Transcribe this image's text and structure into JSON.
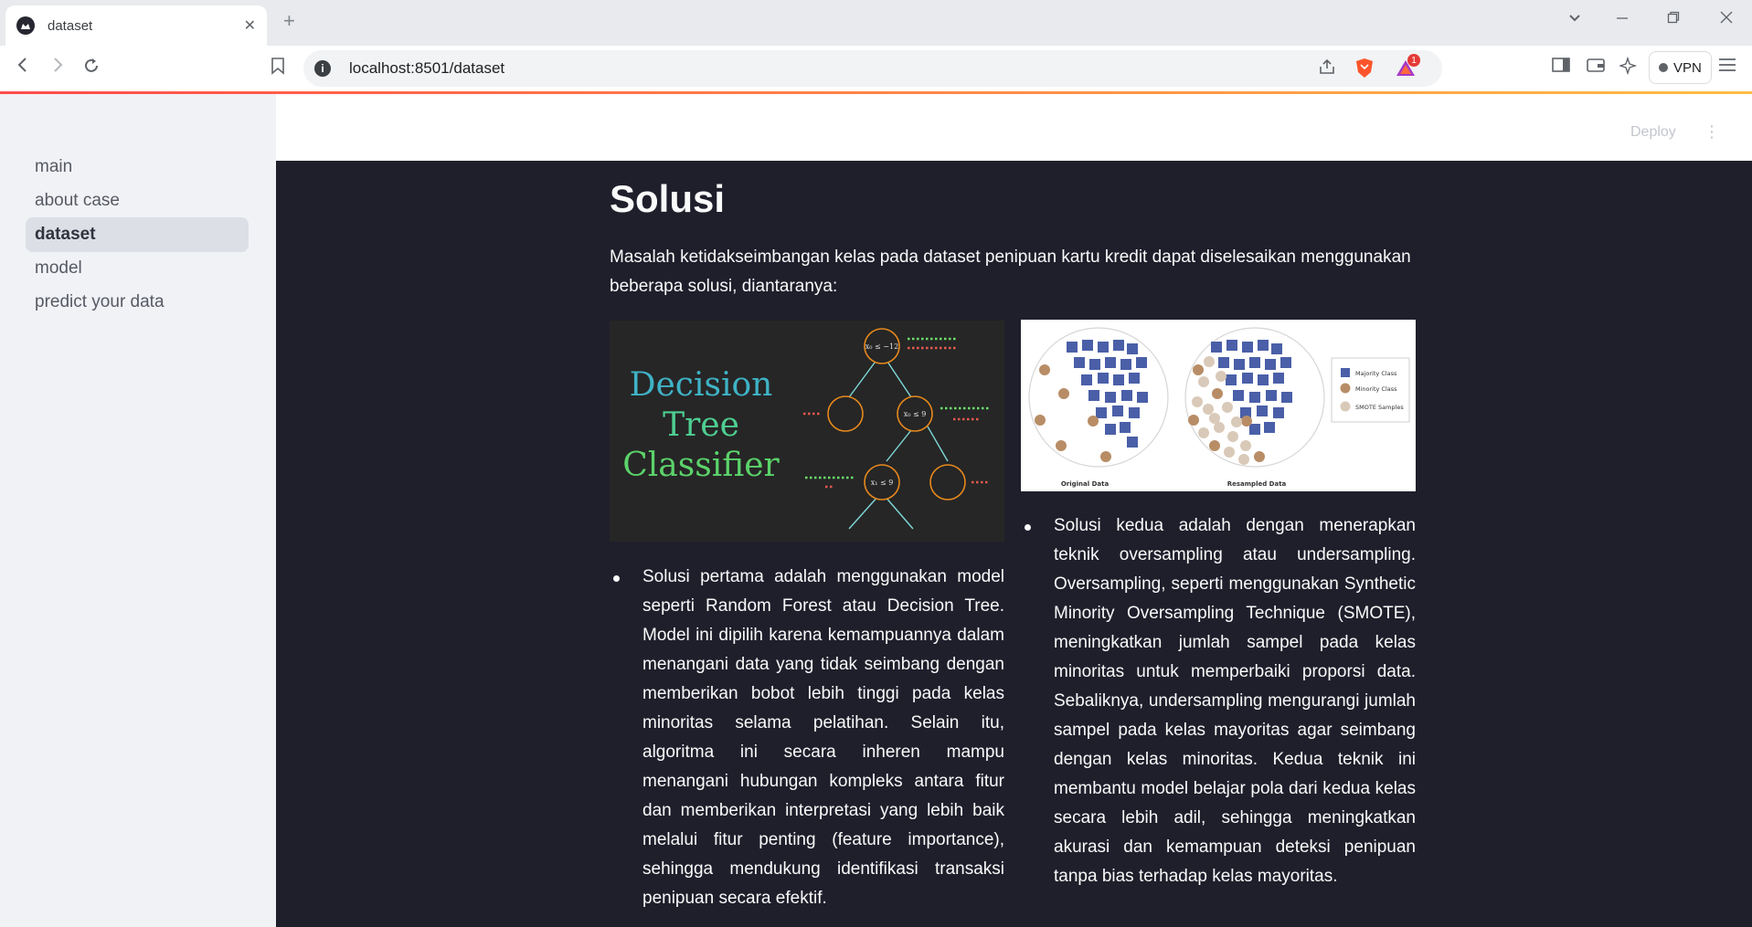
{
  "browser": {
    "tab_title": "dataset",
    "new_tab": "+",
    "close_tab": "✕",
    "url": "localhost:8501/dataset",
    "vpn_label": "VPN",
    "notification_count": "1"
  },
  "sidebar": {
    "items": [
      {
        "label": "main"
      },
      {
        "label": "about case"
      },
      {
        "label": "dataset"
      },
      {
        "label": "model"
      },
      {
        "label": "predict your data"
      }
    ],
    "active": "dataset"
  },
  "header": {
    "deploy_label": "Deploy",
    "menu_icon": "⋮"
  },
  "content": {
    "title": "Solusi",
    "intro": "Masalah ketidakseimbangan kelas pada dataset penipuan kartu kredit dapat diselesaikan menggunakan beberapa solusi, diantaranya:",
    "image1": {
      "title_lines": [
        "Decision",
        "Tree",
        "Classifier"
      ],
      "node_labels": [
        "x₀ ≤ −12",
        "x₀ ≤ 9",
        "x₁ ≤ 9"
      ]
    },
    "image2": {
      "legend": [
        "Majority Class",
        "Minority Class",
        "SMOTE Samples"
      ],
      "captions": [
        "Original Data",
        "Resampled Data"
      ]
    },
    "solution1": "Solusi pertama adalah menggunakan model seperti Random Forest atau Decision Tree. Model ini dipilih karena kemampuannya dalam menangani data yang tidak seimbang dengan memberikan bobot lebih tinggi pada kelas minoritas selama pelatihan. Selain itu, algoritma ini secara inheren mampu menangani hubungan kompleks antara fitur dan memberikan interpretasi yang lebih baik melalui fitur penting (feature importance), sehingga mendukung identifikasi transaksi penipuan secara efektif.",
    "solution2": "Solusi kedua adalah dengan menerapkan teknik oversampling atau undersampling. Oversampling, seperti menggunakan Synthetic Minority Oversampling Technique (SMOTE), meningkatkan jumlah sampel pada kelas minoritas untuk memperbaiki proporsi data. Sebaliknya, undersampling mengurangi jumlah sampel pada kelas mayoritas agar seimbang dengan kelas minoritas. Kedua teknik ini membantu model belajar pola dari kedua kelas secara lebih adil, sehingga meningkatkan akurasi dan kemampuan deteksi penipuan tanpa bias terhadap kelas mayoritas."
  },
  "colors": {
    "main_bg": "#1f1f2c",
    "sidebar_bg": "#f0f2f6",
    "majority": "#4a5fa8",
    "minority": "#b88d66",
    "smote": "#d9c9b8"
  }
}
